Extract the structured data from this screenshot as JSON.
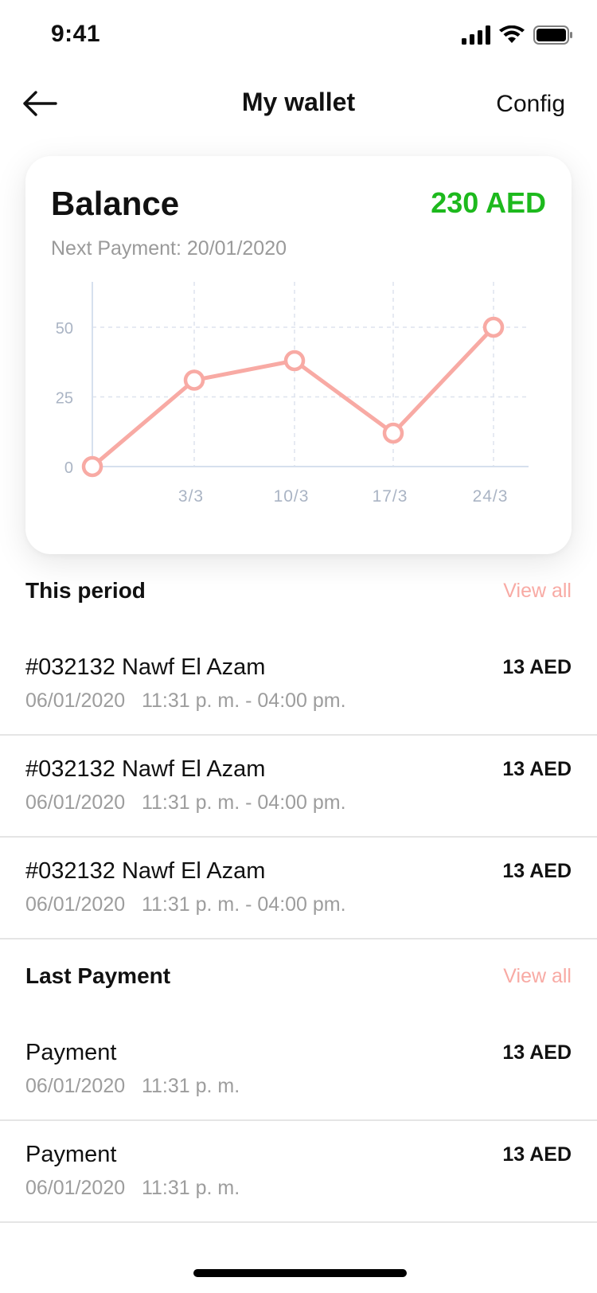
{
  "status_bar": {
    "time": "9:41",
    "icons": [
      "cellular-signal-icon",
      "wifi-icon",
      "battery-icon"
    ]
  },
  "nav": {
    "title": "My wallet",
    "right_label": "Config",
    "back_icon": "arrow-left-icon"
  },
  "balance_card": {
    "label": "Balance",
    "amount": "230 AED",
    "next_payment": "Next Payment: 20/01/2020"
  },
  "chart_data": {
    "type": "line",
    "x": [
      "",
      "3/3",
      "10/3",
      "17/3",
      "24/3"
    ],
    "values": [
      0,
      31,
      38,
      12,
      50
    ],
    "yticks": [
      0,
      25,
      50
    ],
    "ylim": [
      0,
      60
    ],
    "grid": true
  },
  "this_period": {
    "title": "This period",
    "view_all": "View all",
    "items": [
      {
        "title": "#032132 Nawf El Azam",
        "subtitle": "06/01/2020   11:31 p. m. - 04:00 pm.",
        "amount": "13 AED"
      },
      {
        "title": "#032132 Nawf El Azam",
        "subtitle": "06/01/2020   11:31 p. m. - 04:00 pm.",
        "amount": "13 AED"
      },
      {
        "title": "#032132 Nawf El Azam",
        "subtitle": "06/01/2020   11:31 p. m. - 04:00 pm.",
        "amount": "13 AED"
      }
    ]
  },
  "last_payment": {
    "title": "Last Payment",
    "view_all": "View all",
    "items": [
      {
        "title": "Payment",
        "subtitle": "06/01/2020   11:31 p. m.",
        "amount": "13 AED"
      },
      {
        "title": "Payment",
        "subtitle": "06/01/2020   11:31 p. m.",
        "amount": "13 AED"
      }
    ]
  },
  "colors": {
    "accent_green": "#1db91d",
    "accent_pink": "#f8aaa4",
    "chart_axis_text": "#aab4c4",
    "chart_grid": "#dde3ee"
  }
}
